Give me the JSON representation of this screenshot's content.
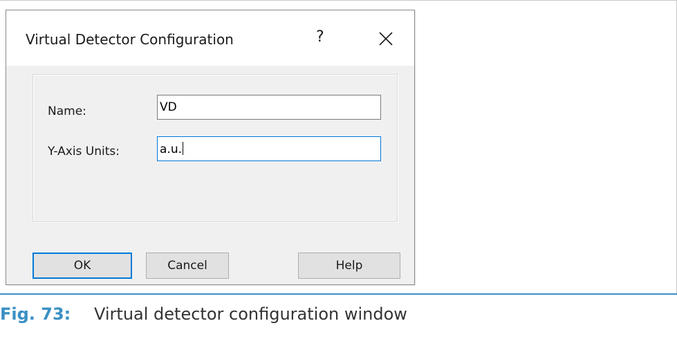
{
  "dialog": {
    "title": "Virtual Detector Configuration",
    "help_glyph": "?",
    "help_icon": "question-mark-icon",
    "close_icon": "close-icon",
    "fields": {
      "name": {
        "label": "Name:",
        "value": "VD"
      },
      "y_axis_units": {
        "label": "Y-Axis Units:",
        "value": "a.u."
      }
    },
    "buttons": {
      "ok": "OK",
      "cancel": "Cancel",
      "help": "Help"
    }
  },
  "figure": {
    "number": "Fig. 73:",
    "caption": "Virtual detector configuration window",
    "accent_color": "#3a90c4"
  },
  "colors": {
    "focus_border": "#0078d7",
    "dialog_background": "#f0f0f0"
  }
}
